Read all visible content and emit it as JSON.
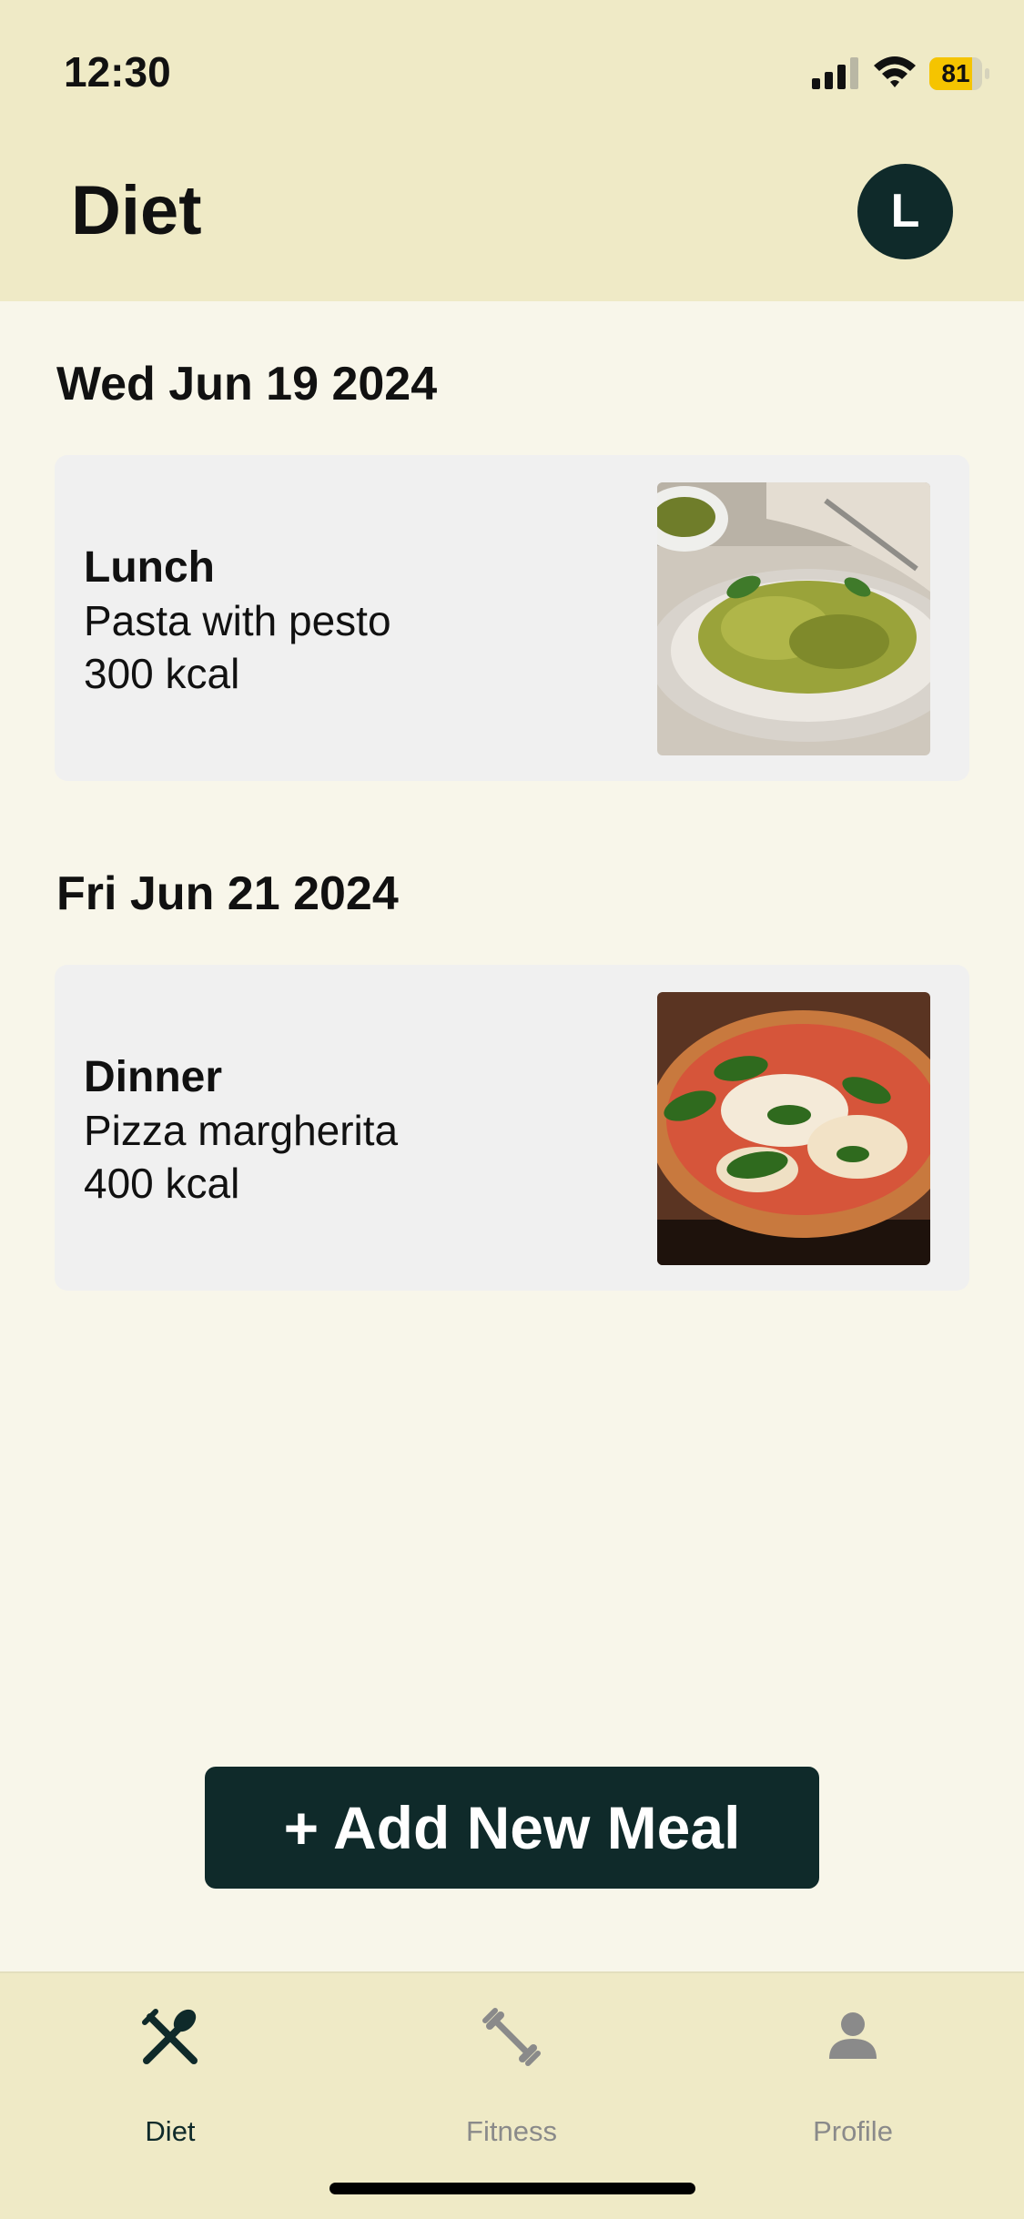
{
  "status": {
    "time": "12:30",
    "battery_level": "81",
    "battery_fraction": 0.81
  },
  "header": {
    "title": "Diet",
    "avatar_initial": "L"
  },
  "entries": [
    {
      "date": "Wed Jun 19 2024",
      "meal_type": "Lunch",
      "meal_name": "Pasta with pesto",
      "kcal": "300 kcal",
      "image": "pasta-pesto-photo"
    },
    {
      "date": "Fri Jun 21 2024",
      "meal_type": "Dinner",
      "meal_name": "Pizza margherita",
      "kcal": "400 kcal",
      "image": "pizza-margherita-photo"
    }
  ],
  "actions": {
    "add_meal": "+ Add New Meal"
  },
  "tabs": [
    {
      "label": "Diet",
      "icon": "utensils-icon",
      "active": true
    },
    {
      "label": "Fitness",
      "icon": "dumbbell-icon",
      "active": false
    },
    {
      "label": "Profile",
      "icon": "person-icon",
      "active": false
    }
  ],
  "colors": {
    "header_bg": "#efeac6",
    "content_bg": "#f8f6ea",
    "card_bg": "#f0f0f0",
    "accent_dark": "#0f2a2a",
    "tab_inactive": "#8a8a8a",
    "battery": "#f5c400"
  }
}
